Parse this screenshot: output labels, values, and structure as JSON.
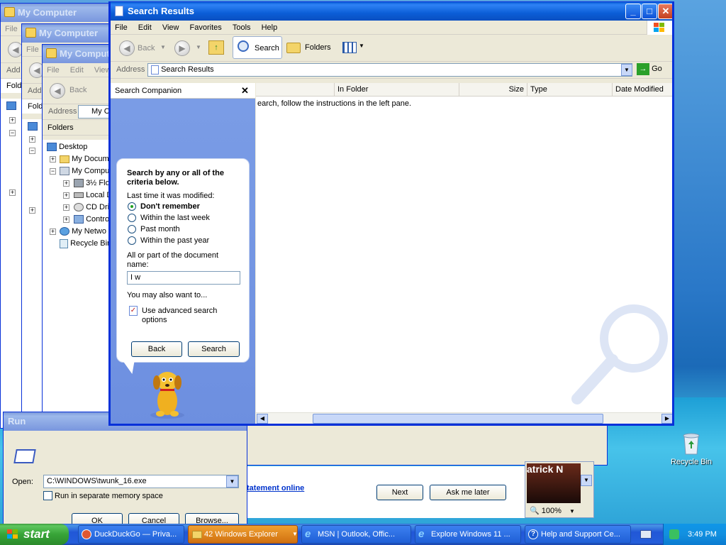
{
  "desktop": {
    "recycle_bin_label": "Recycle Bin"
  },
  "bg_windows": {
    "w1": {
      "title": "My Computer",
      "menu": [
        "File"
      ],
      "back_label": "",
      "address_label": "Add",
      "folders_label": "Fold"
    },
    "w2": {
      "title": "My Computer",
      "menu": [
        "File"
      ],
      "address_label": "Add",
      "folders_label": "Fold"
    },
    "w3": {
      "title": "My Computer",
      "menu": [
        "File",
        "Edit",
        "View"
      ],
      "back_label": "Back",
      "address_label": "Address",
      "address_value": "My C",
      "folders_label": "Folders",
      "tree": [
        {
          "label": "Desktop",
          "icon": "desktop-icon"
        },
        {
          "label": "My Docum",
          "icon": "folder-icon"
        },
        {
          "label": "My Compu",
          "icon": "computer-icon"
        },
        {
          "label": "3½ Flo",
          "icon": "floppy-icon"
        },
        {
          "label": "Local D",
          "icon": "drive-icon"
        },
        {
          "label": "CD Dri",
          "icon": "cd-drive-icon"
        },
        {
          "label": "Contro",
          "icon": "control-panel-icon"
        },
        {
          "label": "My Netwo",
          "icon": "network-icon"
        },
        {
          "label": "Recycle Bin",
          "icon": "recycle-bin-icon"
        }
      ]
    }
  },
  "search_window": {
    "title": "Search Results",
    "menu": [
      "File",
      "Edit",
      "View",
      "Favorites",
      "Tools",
      "Help"
    ],
    "toolbar": {
      "back": "Back",
      "search": "Search",
      "folders": "Folders"
    },
    "address_label": "Address",
    "address_value": "Search Results",
    "go_label": "Go",
    "companion": {
      "header": "Search Companion",
      "heading": "Search by any or all of the criteria below.",
      "last_modified_label": "Last time it was modified:",
      "options": [
        "Don't remember",
        "Within the last week",
        "Past month",
        "Within the past year"
      ],
      "selected_option": "Don't remember",
      "name_label": "All or part of the document name:",
      "name_value": "I w",
      "also_label": "You may also want to...",
      "advanced_label": "Use advanced search options",
      "back_button": "Back",
      "search_button": "Search"
    },
    "columns": [
      "In Folder",
      "Size",
      "Type",
      "Date Modified"
    ],
    "results_message": "earch, follow the instructions in the left pane."
  },
  "run_dialog": {
    "title": "Run",
    "open_label": "Open:",
    "open_value": "C:\\WINDOWS\\twunk_16.exe",
    "separate_memory_label": "Run in separate memory space",
    "ok": "OK",
    "cancel": "Cancel",
    "browse": "Browse..."
  },
  "tour_dialog": {
    "link_text": "tatement online",
    "next": "Next",
    "ask_later": "Ask me later"
  },
  "zoom_window": {
    "zoom_value": "100%",
    "caption": "atrick N"
  },
  "taskbar": {
    "start_label": "start",
    "buttons": [
      {
        "label": "DuckDuckGo — Priva...",
        "icon": "duckduckgo-icon"
      },
      {
        "label": "42 Windows Explorer",
        "icon": "folder-icon"
      },
      {
        "label": "MSN | Outlook, Offic...",
        "icon": "ie-icon"
      },
      {
        "label": "Explore Windows 11 ...",
        "icon": "ie-icon"
      },
      {
        "label": "Help and Support Ce...",
        "icon": "help-icon"
      }
    ],
    "clock": "3:49 PM"
  },
  "colors": {
    "xp_blue": "#0a5fd8",
    "companion_blue": "#7d9ce8",
    "start_green": "#37a437"
  }
}
